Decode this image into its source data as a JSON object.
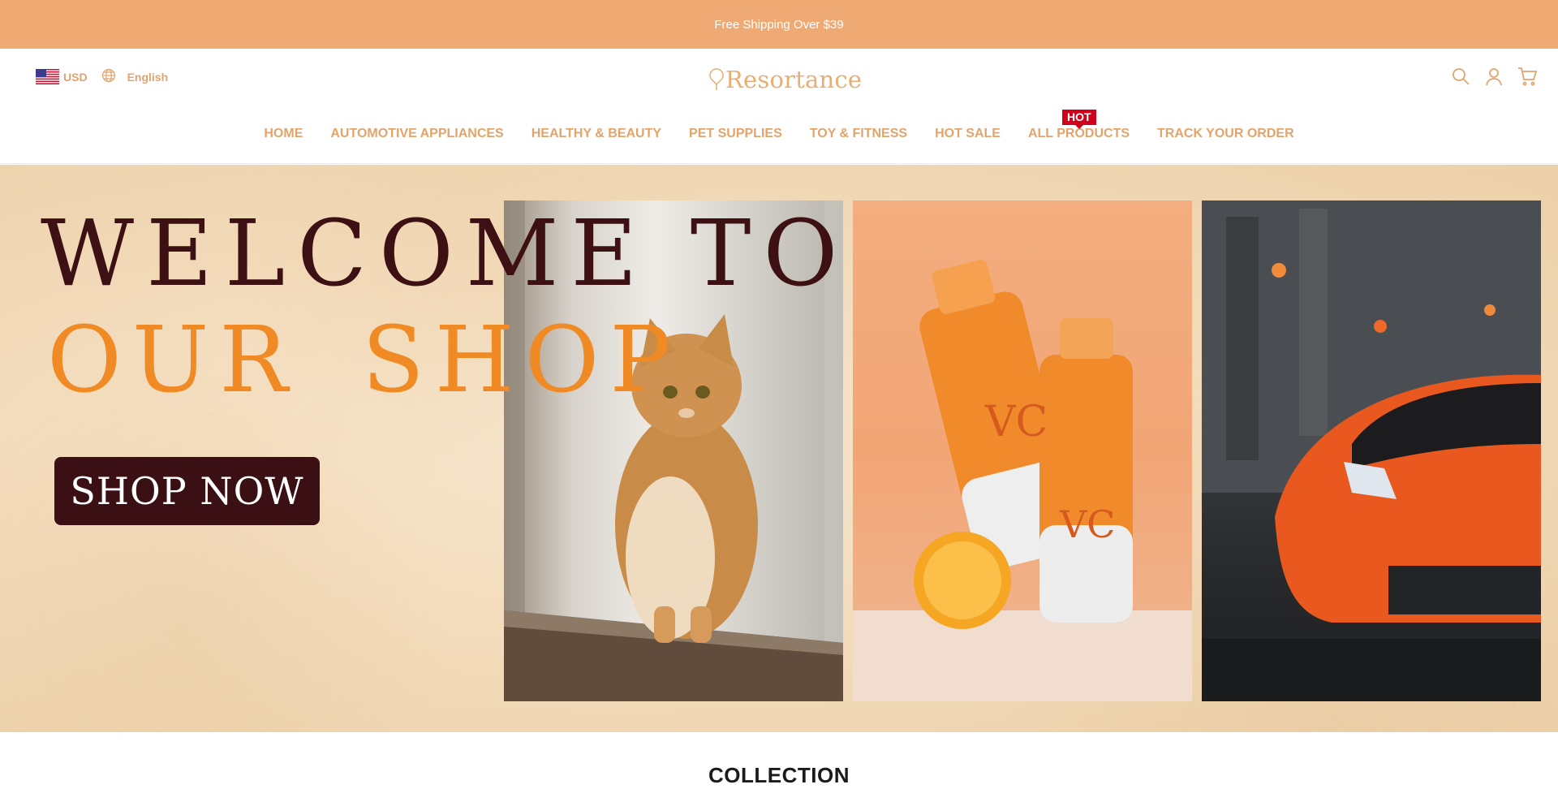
{
  "announcement": {
    "text": "Free Shipping Over $39"
  },
  "header": {
    "currency": "USD",
    "language": "English",
    "logo": "Resortance",
    "nav": [
      {
        "label": "HOME"
      },
      {
        "label": "AUTOMOTIVE APPLIANCES"
      },
      {
        "label": "HEALTHY & BEAUTY"
      },
      {
        "label": "PET SUPPLIES"
      },
      {
        "label": "TOY & FITNESS"
      },
      {
        "label": "HOT SALE"
      },
      {
        "label": "ALL PRODUCTS",
        "badge": "HOT"
      },
      {
        "label": "TRACK YOUR ORDER"
      }
    ],
    "icons": [
      "search-icon",
      "account-icon",
      "cart-icon"
    ]
  },
  "hero": {
    "title_line1": "WELCOME TO",
    "title_line2": "OUR SHOP",
    "button": "SHOP NOW",
    "panel_labels": {
      "vc_big": "VC",
      "vc_small": "VC"
    }
  },
  "collection": {
    "title": "COLLECTION"
  },
  "colors": {
    "announcement_bg": "#eeaa72",
    "nav_text": "#e3a46b",
    "hot_badge": "#d0021b",
    "hero_dark": "#3d1014",
    "hero_orange": "#f08a24"
  }
}
